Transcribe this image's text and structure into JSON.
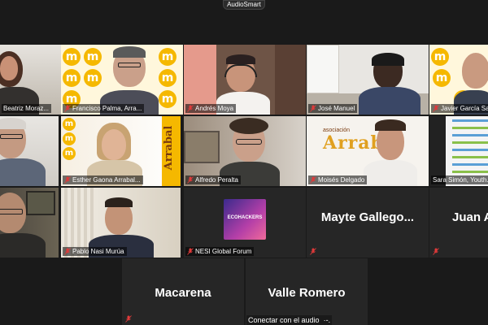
{
  "app": {
    "title": "AudioSmart"
  },
  "participants": [
    {
      "name": "Beatriz Moraz...",
      "row": 0,
      "col": 0
    },
    {
      "name": "Francisco Palma, Arra...",
      "row": 0,
      "col": 1
    },
    {
      "name": "Andrés Moya",
      "row": 0,
      "col": 2
    },
    {
      "name": "José Manuel",
      "row": 0,
      "col": 3
    },
    {
      "name": "Javier García Sante...",
      "row": 0,
      "col": 4,
      "active": true
    },
    {
      "name": "",
      "row": 1,
      "col": 0
    },
    {
      "name": "Esther Gaona Arrabal...",
      "row": 1,
      "col": 1
    },
    {
      "name": "Alfredo Peralta",
      "row": 1,
      "col": 2
    },
    {
      "name": "Moisés Delgado",
      "row": 1,
      "col": 3
    },
    {
      "name": "Sara Simón, Youth...",
      "row": 1,
      "col": 4
    },
    {
      "name": "",
      "row": 2,
      "col": 0
    },
    {
      "name": "Pablo Nasi Murúa",
      "row": 2,
      "col": 1
    },
    {
      "name": "NESI Global Forum",
      "row": 2,
      "col": 2
    },
    {
      "name": "Mayte Gallego...",
      "row": 2,
      "col": 3,
      "avatar_only": true
    },
    {
      "name": "Juan A...",
      "row": 2,
      "col": 4,
      "avatar_only": true
    }
  ],
  "bottom_participants": [
    {
      "name": "Macarena"
    },
    {
      "name": "Valle Romero"
    }
  ],
  "overlays": {
    "arrabal_banner": "Arrabal",
    "asociacion_caption": "asociación",
    "asociacion_logo": "Arrabal",
    "nesi_poster_title": "ECOHACKERS",
    "audio_prompt": "Conectar con el audio"
  },
  "colors": {
    "background": "#1a1a1a",
    "tile": "#262626",
    "active_outline": "#9bd93a",
    "muted_icon": "#e03a3a",
    "arrabal_yellow": "#f5b800"
  },
  "icons": {
    "muted_microphone": "mic-muted-icon"
  }
}
